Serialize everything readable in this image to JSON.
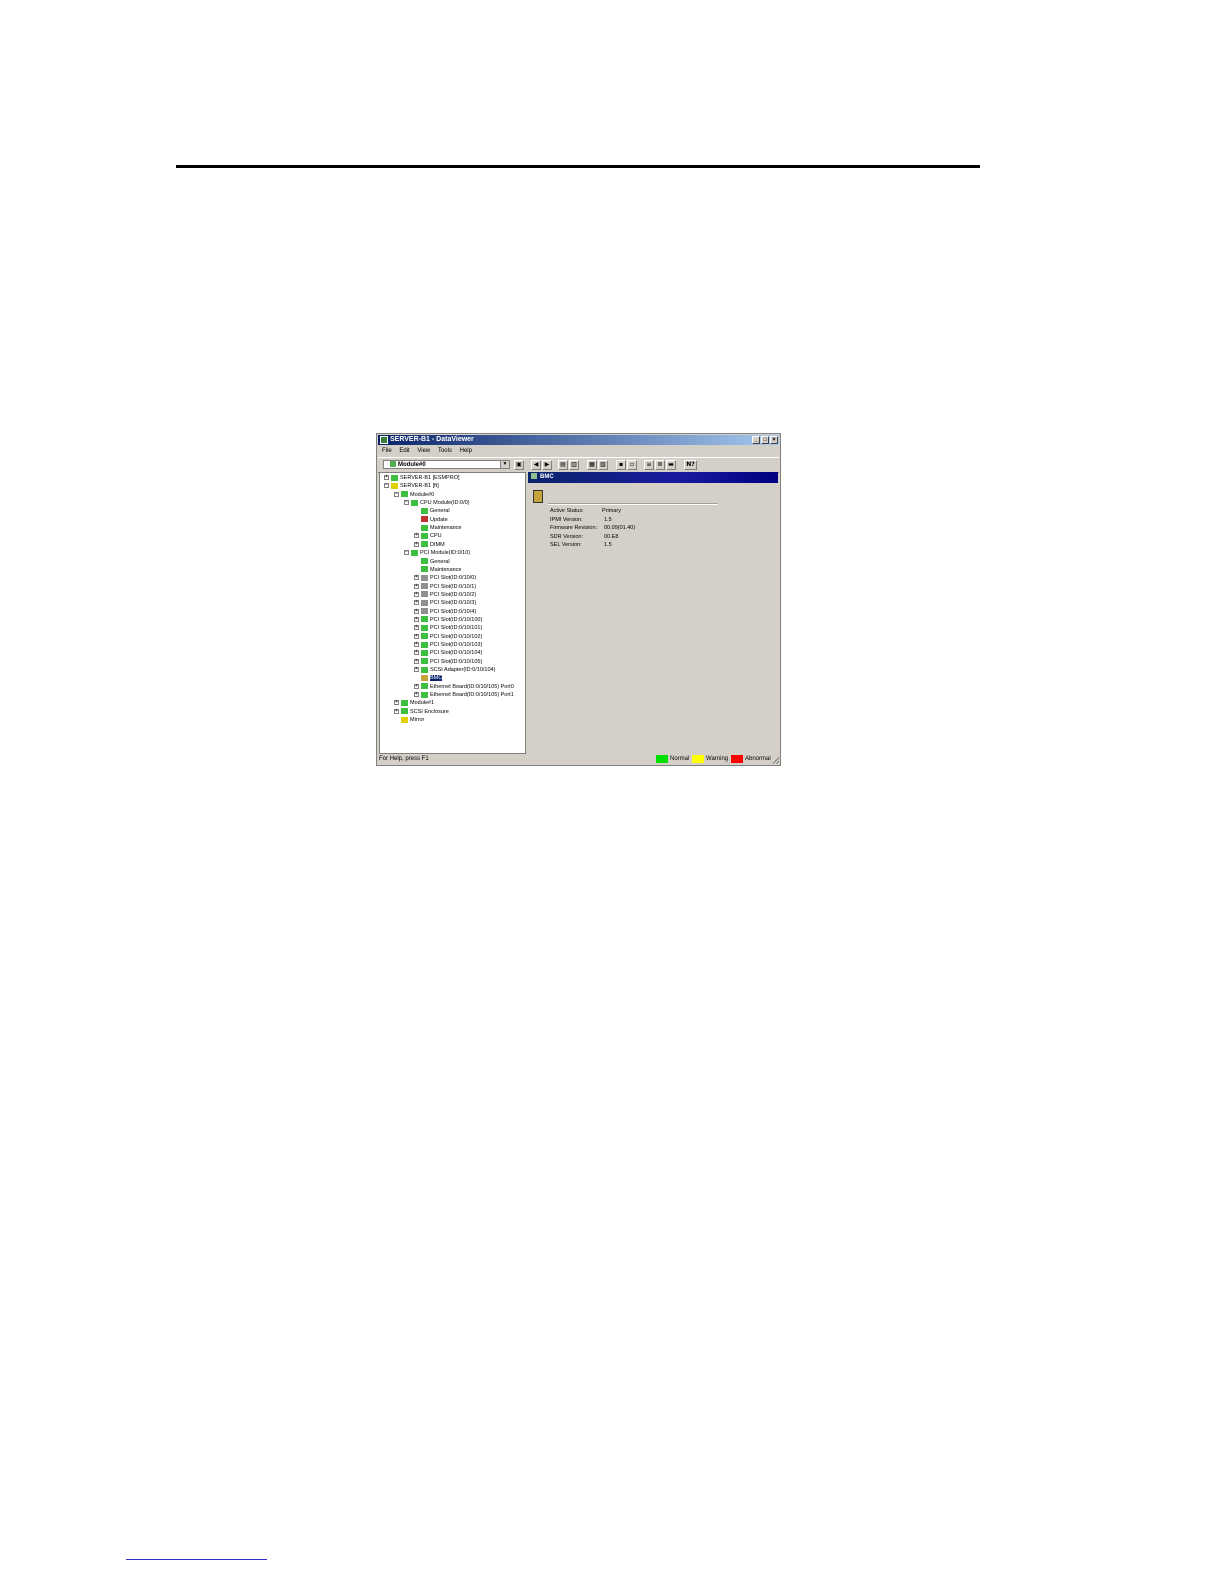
{
  "window": {
    "title": "SERVER-B1 - DataViewer",
    "controls": {
      "minimize": "_",
      "maximize": "□",
      "close": "×"
    }
  },
  "menu": [
    "File",
    "Edit",
    "View",
    "Tools",
    "Help"
  ],
  "toolbar": {
    "combo_value": "Module#0",
    "help_button": "N?"
  },
  "tree": [
    {
      "label": "SERVER-B1 [ESMPRO]",
      "icon": "server-icon",
      "color": "#3fbf3f",
      "expander": "+"
    },
    {
      "label": "SERVER-B1 [ft]",
      "icon": "server-icon",
      "color": "#e0d000",
      "expander": "−"
    },
    {
      "label": "Module#0",
      "icon": "module-icon",
      "color": "#3fbf3f",
      "expander": "−"
    },
    {
      "label": "CPU Module(ID:0/0)",
      "icon": "cpu-module-icon",
      "color": "#3fbf3f",
      "expander": "−"
    },
    {
      "label": "General",
      "icon": "general-icon",
      "color": "#3fbf3f",
      "expander": ""
    },
    {
      "label": "Update",
      "icon": "update-icon",
      "color": "#c03030",
      "expander": ""
    },
    {
      "label": "Maintenance",
      "icon": "maintenance-icon",
      "color": "#3fbf3f",
      "expander": ""
    },
    {
      "label": "CPU",
      "icon": "cpu-icon",
      "color": "#3fbf3f",
      "expander": "+"
    },
    {
      "label": "DIMM",
      "icon": "dimm-icon",
      "color": "#3fbf3f",
      "expander": "+"
    },
    {
      "label": "PCI Module(ID:0/10)",
      "icon": "pci-module-icon",
      "color": "#3fbf3f",
      "expander": "−"
    },
    {
      "label": "General",
      "icon": "general-icon",
      "color": "#3fbf3f",
      "expander": ""
    },
    {
      "label": "Maintenance",
      "icon": "maintenance-icon",
      "color": "#3fbf3f",
      "expander": ""
    },
    {
      "label": "PCI Slot(ID:0/10/0)",
      "icon": "pci-slot-icon",
      "color": "#909090",
      "expander": "+"
    },
    {
      "label": "PCI Slot(ID:0/10/1)",
      "icon": "pci-slot-icon",
      "color": "#909090",
      "expander": "+"
    },
    {
      "label": "PCI Slot(ID:0/10/2)",
      "icon": "pci-slot-icon",
      "color": "#909090",
      "expander": "+"
    },
    {
      "label": "PCI Slot(ID:0/10/3)",
      "icon": "pci-slot-icon",
      "color": "#909090",
      "expander": "+"
    },
    {
      "label": "PCI Slot(ID:0/10/4)",
      "icon": "pci-slot-icon",
      "color": "#909090",
      "expander": "+"
    },
    {
      "label": "PCI Slot(ID:0/10/100)",
      "icon": "pci-slot-icon",
      "color": "#3fbf3f",
      "expander": "+"
    },
    {
      "label": "PCI Slot(ID:0/10/101)",
      "icon": "pci-slot-icon",
      "color": "#3fbf3f",
      "expander": "+"
    },
    {
      "label": "PCI Slot(ID:0/10/102)",
      "icon": "pci-slot-icon",
      "color": "#3fbf3f",
      "expander": "+"
    },
    {
      "label": "PCI Slot(ID:0/10/103)",
      "icon": "pci-slot-icon",
      "color": "#3fbf3f",
      "expander": "+"
    },
    {
      "label": "PCI Slot(ID:0/10/104)",
      "icon": "pci-slot-icon",
      "color": "#3fbf3f",
      "expander": "+"
    },
    {
      "label": "PCI Slot(ID:0/10/105)",
      "icon": "pci-slot-icon",
      "color": "#3fbf3f",
      "expander": "+"
    },
    {
      "label": "SCSI Adapter(ID:0/10/104)",
      "icon": "scsi-adapter-icon",
      "color": "#3fbf3f",
      "expander": "+"
    },
    {
      "label": "BMC",
      "icon": "bmc-icon",
      "color": "#c8a23a",
      "expander": "",
      "selected": true
    },
    {
      "label": "Ethernet Board(ID:0/10/105) Port0",
      "icon": "ethernet-icon",
      "color": "#3fbf3f",
      "expander": "+"
    },
    {
      "label": "Ethernet Board(ID:0/10/105) Port1",
      "icon": "ethernet-icon",
      "color": "#3fbf3f",
      "expander": "+"
    },
    {
      "label": "Module#1",
      "icon": "module-icon",
      "color": "#3fbf3f",
      "expander": "+"
    },
    {
      "label": "SCSI Enclosure",
      "icon": "scsi-enclosure-icon",
      "color": "#3fbf3f",
      "expander": "+"
    },
    {
      "label": "Mirror",
      "icon": "mirror-icon",
      "color": "#e0d000",
      "expander": ""
    }
  ],
  "detail": {
    "header": "BMC",
    "properties": [
      {
        "label": "Active Status:",
        "value": "Primary"
      },
      {
        "label": "IPMI Version:",
        "value": "1.5"
      },
      {
        "label": "Firmware Revision:",
        "value": "00.09(01.40)"
      },
      {
        "label": "SDR Version:",
        "value": "00.E8"
      },
      {
        "label": "SEL Version:",
        "value": "1.5"
      }
    ]
  },
  "statusbar": {
    "help_text": "For Help, press F1",
    "legend": [
      {
        "label": "Normal",
        "color": "#00e000"
      },
      {
        "label": "Warning",
        "color": "#ffff00"
      },
      {
        "label": "Abnormal",
        "color": "#ff0000"
      }
    ]
  }
}
